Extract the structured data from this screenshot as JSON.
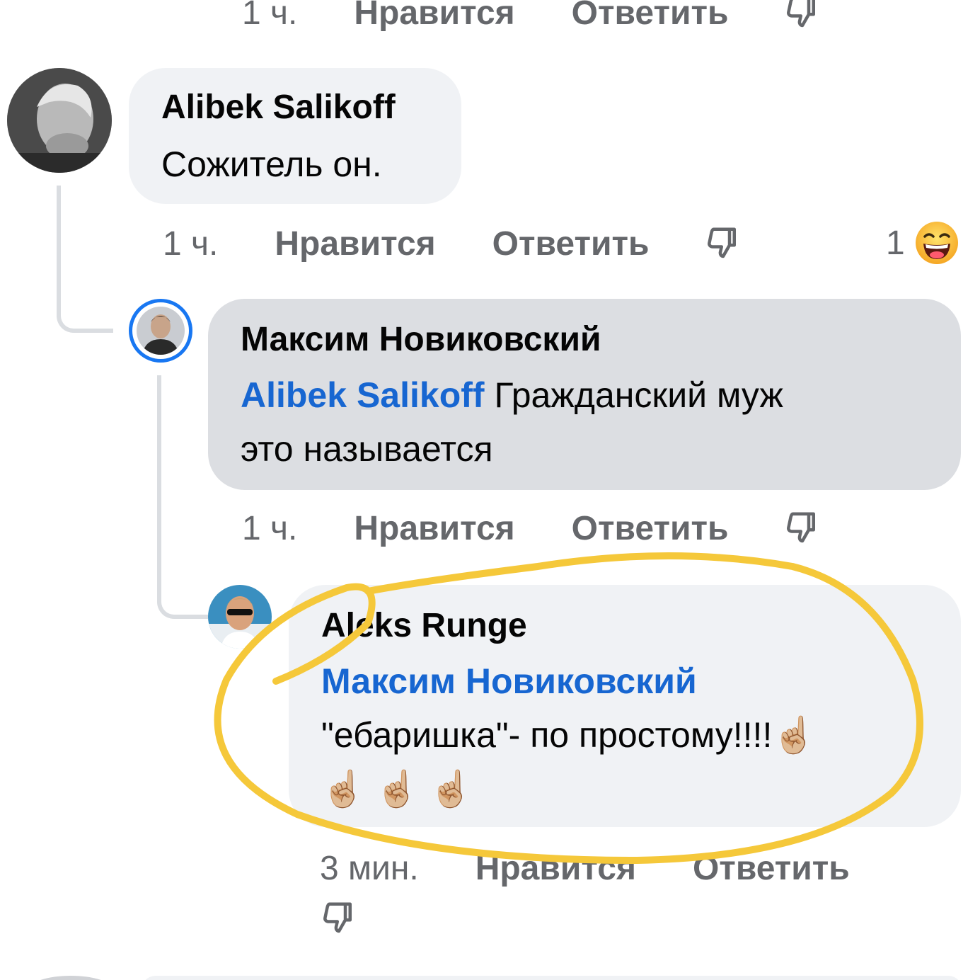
{
  "top_actions": {
    "time": "1 ч.",
    "like": "Нравится",
    "reply": "Ответить"
  },
  "comments": [
    {
      "author": "Alibek Salikoff",
      "text": "Сожитель он.",
      "time": "1 ч.",
      "like": "Нравится",
      "reply": "Ответить",
      "reaction_count": "1",
      "reaction_icon": "laughing-emoji"
    },
    {
      "author": "Максим Новиковский",
      "mention": "Alibek Salikoff",
      "text_line1": "Гражданский муж",
      "text_line2": "это называется",
      "time": "1 ч.",
      "like": "Нравится",
      "reply": "Ответить"
    },
    {
      "author": "Aleks Runge",
      "mention": "Максим Новиковский",
      "text": "\"ебаришка\"- по простому!!!!",
      "emoji": "☝🏼",
      "time": "3 мин.",
      "like": "Нравится",
      "reply": "Ответить"
    }
  ],
  "colors": {
    "bubble_light": "#f0f2f5",
    "bubble_highlight": "#dcdee2",
    "mention": "#1766d1",
    "meta": "#65676b",
    "annotation": "#f5c83a",
    "avatar_ring": "#1877f2"
  }
}
